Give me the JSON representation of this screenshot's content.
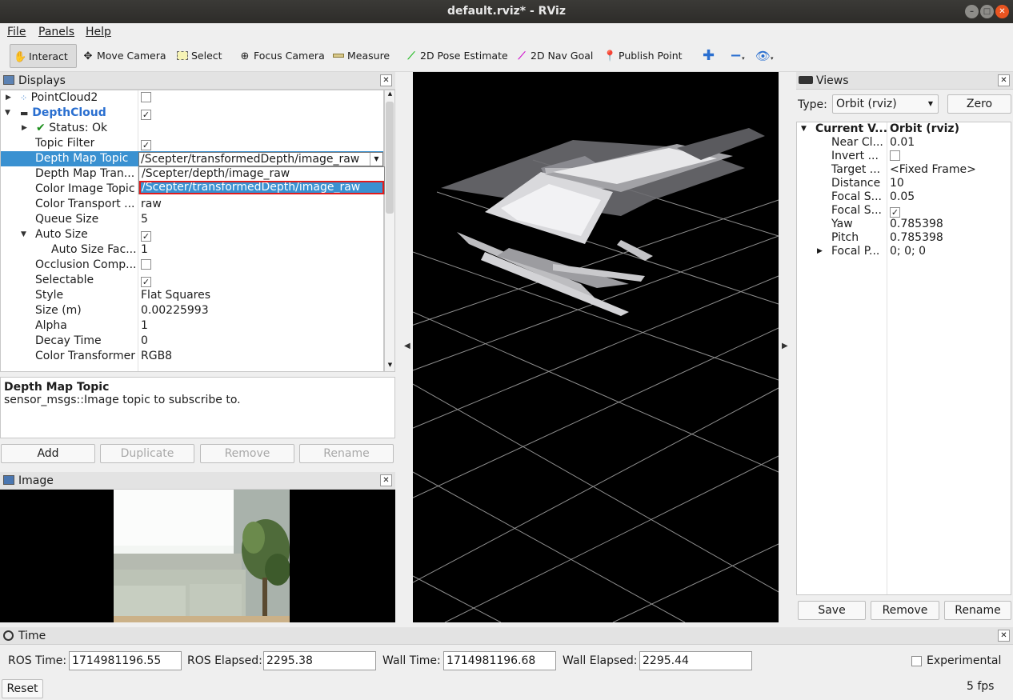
{
  "window": {
    "title": "default.rviz* - RViz"
  },
  "menu": {
    "file": "File",
    "panels": "Panels",
    "help": "Help"
  },
  "toolbar": {
    "interact": "Interact",
    "move_camera": "Move Camera",
    "select": "Select",
    "focus_camera": "Focus Camera",
    "measure": "Measure",
    "pose_estimate": "2D Pose Estimate",
    "nav_goal": "2D Nav Goal",
    "publish_point": "Publish Point"
  },
  "displays": {
    "title": "Displays",
    "rows": [
      {
        "key": "PointCloud2",
        "value": ""
      },
      {
        "key": "DepthCloud",
        "value": ""
      },
      {
        "key": "Status: Ok",
        "value": ""
      },
      {
        "key": "Topic Filter",
        "value": ""
      },
      {
        "key": "Depth Map Topic",
        "value": ""
      },
      {
        "key": "Depth Map Tran...",
        "value": ""
      },
      {
        "key": "Color Image Topic",
        "value": ""
      },
      {
        "key": "Color Transport ...",
        "value": "raw"
      },
      {
        "key": "Queue Size",
        "value": "5"
      },
      {
        "key": "Auto Size",
        "value": ""
      },
      {
        "key": "Auto Size Fac...",
        "value": "1"
      },
      {
        "key": "Occlusion Comp...",
        "value": ""
      },
      {
        "key": "Selectable",
        "value": ""
      },
      {
        "key": "Style",
        "value": "Flat Squares"
      },
      {
        "key": "Size (m)",
        "value": "0.00225993"
      },
      {
        "key": "Alpha",
        "value": "1"
      },
      {
        "key": "Decay Time",
        "value": "0"
      },
      {
        "key": "Color Transformer",
        "value": "RGB8"
      }
    ],
    "combo_value": "/Scepter/transformedDepth/image_raw",
    "dropdown_options": [
      "/Scepter/depth/image_raw",
      "/Scepter/transformedDepth/image_raw"
    ]
  },
  "description": {
    "title": "Depth Map Topic",
    "text": "sensor_msgs::Image topic to subscribe to."
  },
  "display_buttons": {
    "add": "Add",
    "duplicate": "Duplicate",
    "remove": "Remove",
    "rename": "Rename"
  },
  "image_panel": {
    "title": "Image"
  },
  "views": {
    "title": "Views",
    "type_label": "Type:",
    "type_value": "Orbit (rviz)",
    "zero": "Zero",
    "rows": [
      {
        "key": "Current V...",
        "value": "Orbit (rviz)"
      },
      {
        "key": "Near Cl...",
        "value": "0.01"
      },
      {
        "key": "Invert ...",
        "value": ""
      },
      {
        "key": "Target ...",
        "value": "<Fixed Frame>"
      },
      {
        "key": "Distance",
        "value": "10"
      },
      {
        "key": "Focal S...",
        "value": "0.05"
      },
      {
        "key": "Focal S...",
        "value": ""
      },
      {
        "key": "Yaw",
        "value": "0.785398"
      },
      {
        "key": "Pitch",
        "value": "0.785398"
      },
      {
        "key": "Focal P...",
        "value": "0; 0; 0"
      }
    ],
    "save": "Save",
    "remove": "Remove",
    "rename": "Rename"
  },
  "time": {
    "title": "Time",
    "ros_time_label": "ROS Time:",
    "ros_time": "1714981196.55",
    "ros_elapsed_label": "ROS Elapsed:",
    "ros_elapsed": "2295.38",
    "wall_time_label": "Wall Time:",
    "wall_time": "1714981196.68",
    "wall_elapsed_label": "Wall Elapsed:",
    "wall_elapsed": "2295.44",
    "experimental": "Experimental",
    "reset": "Reset",
    "fps": "5 fps"
  },
  "colors": {
    "selection": "#3a91d1",
    "highlight_border": "#e21b1b",
    "title_bar": "#2d2c29",
    "close_button": "#e95420"
  },
  "icons": [
    "hand-icon",
    "move-camera-icon",
    "select-icon",
    "focus-icon",
    "measure-icon",
    "pose-arrow-icon",
    "nav-arrow-icon",
    "map-pin-icon",
    "plus-icon",
    "minus-icon",
    "eye-icon"
  ]
}
